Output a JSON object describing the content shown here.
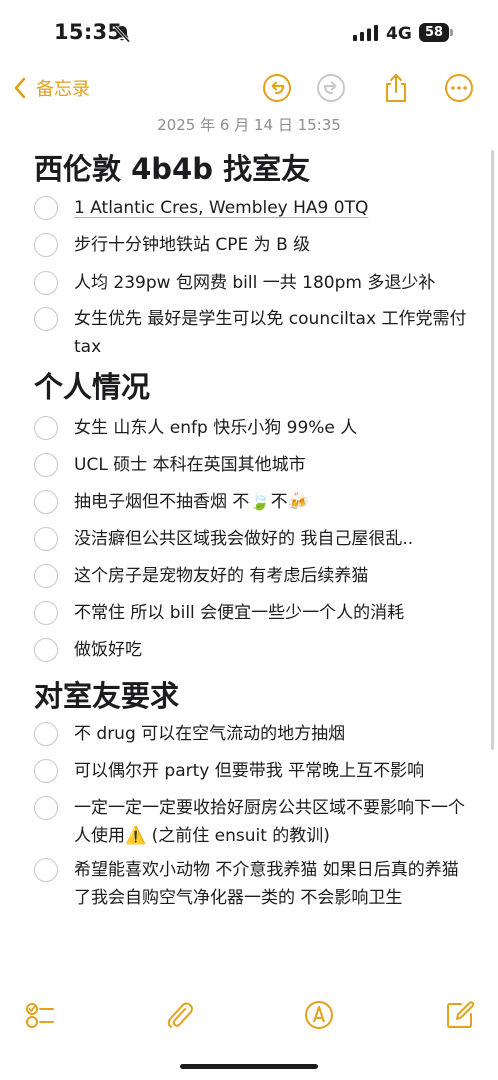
{
  "status_bar": {
    "time": "15:35",
    "network": "4G",
    "battery": "58"
  },
  "nav": {
    "back_label": "备忘录"
  },
  "note": {
    "date": "2025 年 6 月 14 日 15:35",
    "title": "西伦敦 4b4b 找室友",
    "section1_items": [
      "1 Atlantic Cres, Wembley HA9 0TQ",
      "步行十分钟地铁站 CPE 为 B 级",
      "人均 239pw 包网费 bill 一共 180pm 多退少补",
      "女生优先 最好是学生可以免 counciltax 工作党需付 tax"
    ],
    "section2_heading": "个人情况",
    "section2_items": [
      "女生 山东人 enfp 快乐小狗 99%e 人",
      "UCL 硕士 本科在英国其他城市",
      "抽电子烟但不抽香烟 不🍃不🍻",
      "没洁癖但公共区域我会做好的 我自己屋很乱..",
      "这个房子是宠物友好的 有考虑后续养猫",
      "不常住 所以 bill 会便宜一些少一个人的消耗",
      "做饭好吃"
    ],
    "section3_heading": "对室友要求",
    "section3_items": [
      "不 drug 可以在空气流动的地方抽烟",
      "可以偶尔开 party 但要带我 平常晚上互不影响",
      "一定一定一定要收拾好厨房公共区域不要影响下一个人使用⚠️ (之前住 ensuit 的教训)",
      "希望能喜欢小动物 不介意我养猫 如果日后真的养猫了我会自购空气净化器一类的 不会影响卫生"
    ]
  },
  "colors": {
    "accent": "#E2A21B",
    "checkbox_border": "#C7C7CC",
    "date_text": "#8E8E93"
  },
  "icons": {
    "status": [
      "bell-slash-icon",
      "signal-icon",
      "battery-icon"
    ],
    "nav": [
      "chevron-left-icon",
      "undo-icon",
      "redo-icon",
      "share-icon",
      "more-icon"
    ],
    "toolbar": [
      "checklist-icon",
      "paperclip-icon",
      "markup-pen-icon",
      "compose-icon"
    ]
  }
}
